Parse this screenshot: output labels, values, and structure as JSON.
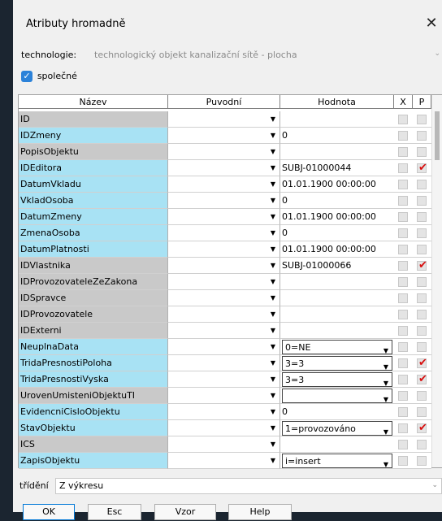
{
  "window": {
    "title": "Atributy hromadně",
    "close_icon": "close-icon"
  },
  "technology": {
    "label": "technologie:",
    "value": "technologický objekt kanalizační sítě - plocha"
  },
  "common": {
    "label": "společné",
    "checked": true
  },
  "grid": {
    "headers": {
      "name": "Název",
      "original": "Puvodní",
      "value": "Hodnota",
      "x": "X",
      "p": "P"
    },
    "colors": {
      "blue": "#a8e2f4",
      "gray": "#c9c9c9"
    },
    "rows": [
      {
        "name": "ID",
        "color": "gray",
        "value": "",
        "valbox": false,
        "p": false
      },
      {
        "name": "IDZmeny",
        "color": "blue",
        "value": "0",
        "valbox": false,
        "p": false
      },
      {
        "name": "PopisObjektu",
        "color": "gray",
        "value": "",
        "valbox": false,
        "p": false
      },
      {
        "name": "IDEditora",
        "color": "blue",
        "value": "SUBJ-01000044",
        "valbox": false,
        "p": true
      },
      {
        "name": "DatumVkladu",
        "color": "blue",
        "value": " 01.01.1900 00:00:00",
        "valbox": false,
        "p": false
      },
      {
        "name": "VkladOsoba",
        "color": "blue",
        "value": "0",
        "valbox": false,
        "p": false
      },
      {
        "name": "DatumZmeny",
        "color": "blue",
        "value": " 01.01.1900 00:00:00",
        "valbox": false,
        "p": false
      },
      {
        "name": "ZmenaOsoba",
        "color": "blue",
        "value": "0",
        "valbox": false,
        "p": false
      },
      {
        "name": "DatumPlatnosti",
        "color": "blue",
        "value": " 01.01.1900 00:00:00",
        "valbox": false,
        "p": false
      },
      {
        "name": "IDVlastnika",
        "color": "gray",
        "value": "SUBJ-01000066",
        "valbox": false,
        "p": true
      },
      {
        "name": "IDProvozovateleZeZakona",
        "color": "gray",
        "value": "",
        "valbox": false,
        "p": false
      },
      {
        "name": "IDSpravce",
        "color": "gray",
        "value": "",
        "valbox": false,
        "p": false
      },
      {
        "name": "IDProvozovatele",
        "color": "gray",
        "value": "",
        "valbox": false,
        "p": false
      },
      {
        "name": "IDExterni",
        "color": "gray",
        "value": "",
        "valbox": false,
        "p": false
      },
      {
        "name": "NeuplnaData",
        "color": "blue",
        "value": "0=NE",
        "valbox": true,
        "p": false
      },
      {
        "name": "TridaPresnostiPoloha",
        "color": "blue",
        "value": "3=3",
        "valbox": true,
        "p": true
      },
      {
        "name": "TridaPresnostiVyska",
        "color": "blue",
        "value": "3=3",
        "valbox": true,
        "p": true
      },
      {
        "name": "UrovenUmisteniObjektuTI",
        "color": "gray",
        "value": "",
        "valbox": true,
        "p": false
      },
      {
        "name": "EvidencniCisloObjektu",
        "color": "blue",
        "value": "0",
        "valbox": false,
        "p": false
      },
      {
        "name": "StavObjektu",
        "color": "blue",
        "value": " 1=provozováno",
        "valbox": true,
        "p": true
      },
      {
        "name": "ICS",
        "color": "gray",
        "value": "",
        "valbox": false,
        "p": false
      },
      {
        "name": "ZapisObjektu",
        "color": "blue",
        "value": "i=insert",
        "valbox": true,
        "p": false
      }
    ]
  },
  "sort": {
    "label": "třídění",
    "value": "Z výkresu"
  },
  "buttons": {
    "ok": "OK",
    "esc": "Esc",
    "vzor": "Vzor",
    "help": "Help"
  }
}
